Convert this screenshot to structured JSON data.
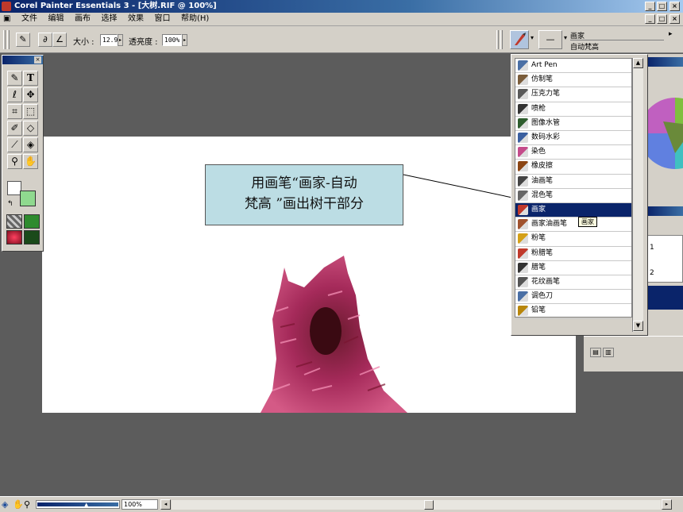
{
  "window": {
    "title": "Corel Painter Essentials 3 - [大树.RIF @ 100%]",
    "controls": [
      "_",
      "□",
      "×"
    ]
  },
  "menu": {
    "items": [
      "文件",
      "编辑",
      "画布",
      "选择",
      "效果",
      "窗口",
      "帮助(H)"
    ]
  },
  "propbar": {
    "size_label": "大小 :",
    "size_value": "12.9",
    "opacity_label": "透亮度 :",
    "opacity_value": "100%"
  },
  "brush_selector": {
    "category": "画家",
    "variant": "自动梵高"
  },
  "callout": {
    "line1": "用画笔“画家-自动",
    "line2": "梵高 ”画出树干部分"
  },
  "brush_list": {
    "items": [
      {
        "label": "Art Pen",
        "color": "#4a6fa5"
      },
      {
        "label": "仿制笔",
        "color": "#7a5c3a"
      },
      {
        "label": "压克力笔",
        "color": "#5a5a5a"
      },
      {
        "label": "喷枪",
        "color": "#333333"
      },
      {
        "label": "图像水管",
        "color": "#2e5d2e"
      },
      {
        "label": "数码水彩",
        "color": "#3a5fa0"
      },
      {
        "label": "染色",
        "color": "#c44b8a"
      },
      {
        "label": "橡皮擦",
        "color": "#8b4513"
      },
      {
        "label": "油画笔",
        "color": "#444444"
      },
      {
        "label": "混色笔",
        "color": "#666666"
      },
      {
        "label": "画家",
        "color": "#c0392b"
      },
      {
        "label": "画家油画笔",
        "color": "#a0522d"
      },
      {
        "label": "粉笔",
        "color": "#d4a017"
      },
      {
        "label": "粉腊笔",
        "color": "#c0392b"
      },
      {
        "label": "腊笔",
        "color": "#333333"
      },
      {
        "label": "花纹画笔",
        "color": "#555555"
      },
      {
        "label": "调色刀",
        "color": "#4a6fa5"
      },
      {
        "label": "铅笔",
        "color": "#b8860b"
      }
    ],
    "selected_index": 10,
    "tooltip": "画家"
  },
  "right_panel": {
    "layer_numbers": [
      "1",
      "2"
    ]
  },
  "status": {
    "zoom": "100%"
  }
}
